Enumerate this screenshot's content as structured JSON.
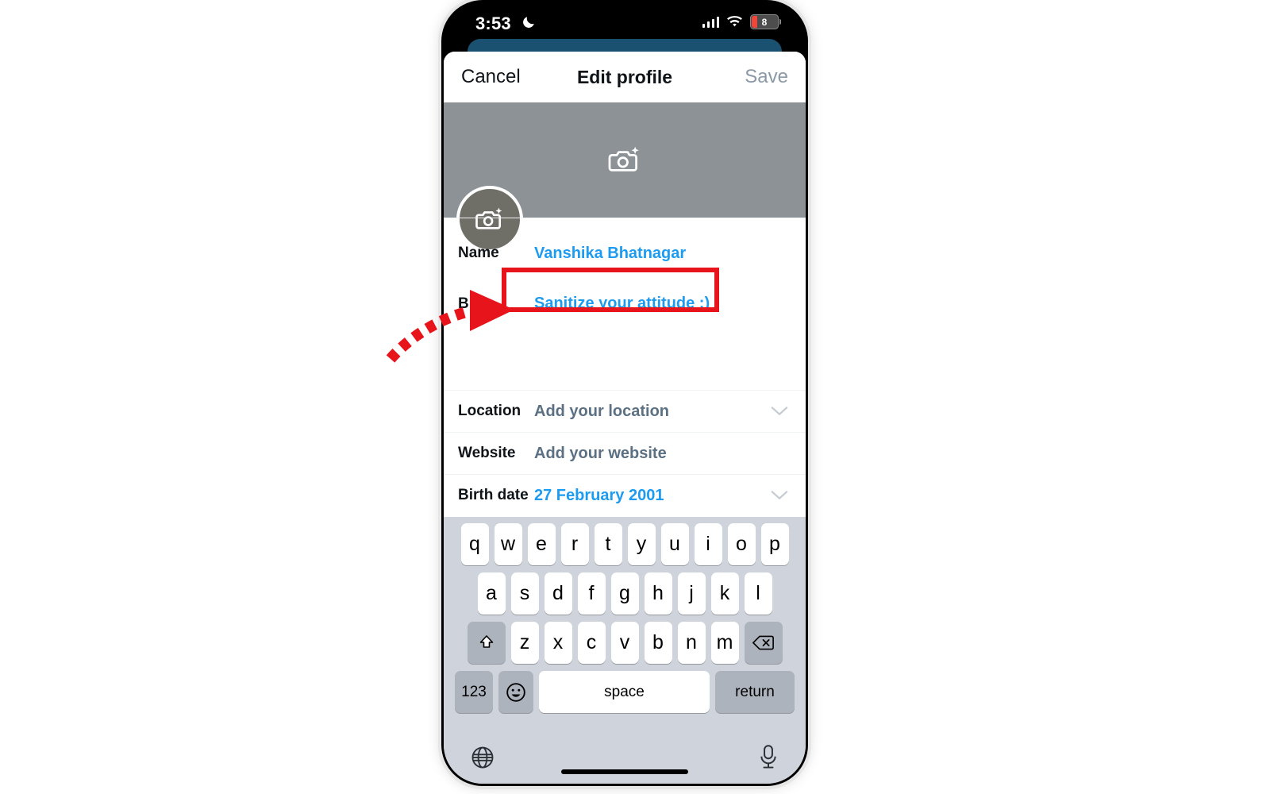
{
  "status_bar": {
    "time": "3:53",
    "dnd_icon": "crescent-moon-icon",
    "signal_icon": "cellular-signal-icon",
    "wifi_icon": "wifi-icon",
    "battery_level": "8",
    "battery_color": "#f0463a"
  },
  "navbar": {
    "cancel_label": "Cancel",
    "title": "Edit profile",
    "save_label": "Save",
    "save_color": "#8b98a5"
  },
  "header": {
    "banner_camera_icon": "camera-add-icon",
    "avatar_camera_icon": "camera-add-icon",
    "banner_color": "#8d9296",
    "avatar_color": "#6f6f67"
  },
  "form": {
    "accent_color": "#1d9bf0",
    "rows": [
      {
        "label": "Name",
        "value": "Vanshika Bhatnagar",
        "style": "blue",
        "chevron": false
      },
      {
        "label": "Bio",
        "value": "Sanitize your attitude :)",
        "style": "blue",
        "chevron": false
      },
      {
        "label": "Location",
        "value": "Add your location",
        "style": "placeholder",
        "chevron": true
      },
      {
        "label": "Website",
        "value": "Add your website",
        "style": "placeholder",
        "chevron": false
      },
      {
        "label": "Birth date",
        "value": "27 February 2001",
        "style": "blue",
        "chevron": true
      }
    ]
  },
  "keyboard": {
    "row1": [
      "q",
      "w",
      "e",
      "r",
      "t",
      "y",
      "u",
      "i",
      "o",
      "p"
    ],
    "row2": [
      "a",
      "s",
      "d",
      "f",
      "g",
      "h",
      "j",
      "k",
      "l"
    ],
    "row3": [
      "z",
      "x",
      "c",
      "v",
      "b",
      "n",
      "m"
    ],
    "shift_icon": "shift-arrow-icon",
    "backspace_icon": "backspace-delete-icon",
    "numbers_label": "123",
    "emoji_icon": "emoji-smiley-icon",
    "space_label": "space",
    "return_label": "return",
    "globe_icon": "globe-language-icon",
    "mic_icon": "microphone-icon"
  },
  "annotation": {
    "highlight_color": "#e8141b",
    "arrow_icon": "dashed-curved-arrow-icon",
    "highlight_target": "Name"
  }
}
